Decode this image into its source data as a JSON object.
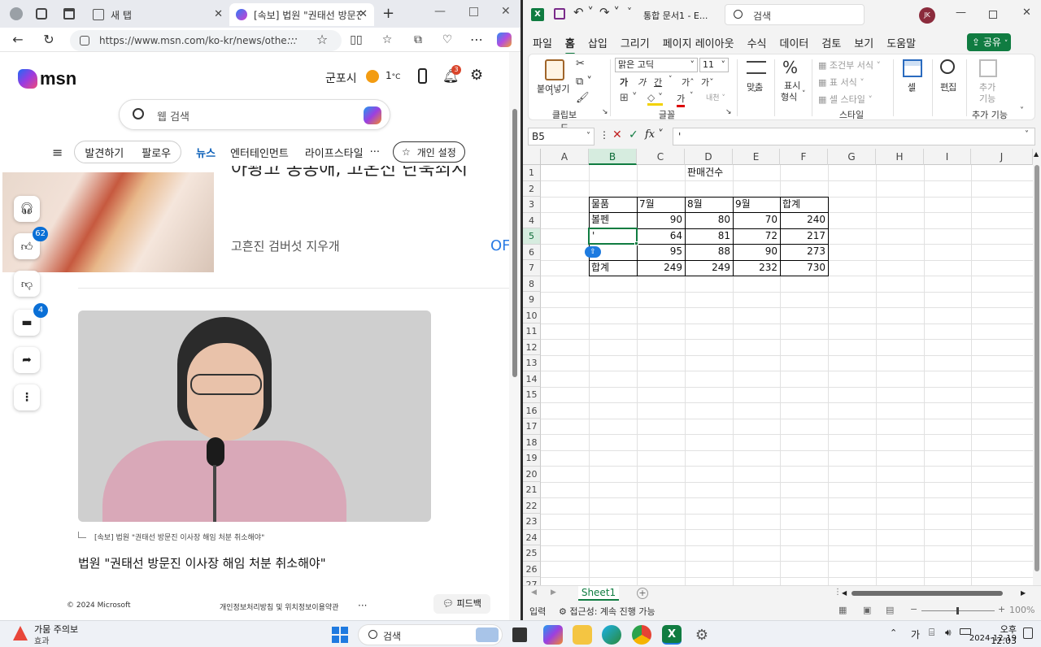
{
  "browser": {
    "tabs": [
      {
        "label": "새 탭",
        "icon": "new-tab-icon"
      },
      {
        "label": "[속보] 법원 \"권태선 방문진",
        "icon": "msn-icon"
      }
    ],
    "url": "https://www.msn.com/ko-kr/news/othe...",
    "msn": {
      "logo": "msn",
      "location": "군포시",
      "temperature": "1",
      "temp_unit": "°C",
      "notif_count": "3",
      "search_placeholder": "웹 검색",
      "nav_items": [
        "발견하기",
        "팔로우",
        "뉴스",
        "엔터테인먼트",
        "라이프스타일"
      ],
      "nav_more": "···",
      "personalize": "개인 설정",
      "headline_partial": "아꽝고 농농애, 고온신 난욱쇠시",
      "related_title": "고흔진 검버섯 지우개",
      "related_tag": "OF",
      "like_count": "62",
      "comment_count": "4",
      "caption": "[속보] 법원 \"권태선 방문진 이사장 해임 처분 취소해야\"",
      "article_title": "법원 \"권태선 방문진 이사장 해임 처분 취소해야\"",
      "footer_copyright": "© 2024 Microsoft",
      "footer_links": "개인정보처리방침 및 위치정보이용약관",
      "footer_more": "···",
      "feedback": "피드백"
    }
  },
  "excel": {
    "title": "통합 문서1 - E...",
    "search": "검색",
    "user_initials": "JK",
    "menu": [
      "파일",
      "홈",
      "삽입",
      "그리기",
      "페이지 레이아웃",
      "수식",
      "데이터",
      "검토",
      "보기",
      "도움말"
    ],
    "share": "공유",
    "ribbon": {
      "paste": "붙여넣기",
      "clipboard": "클립보드",
      "font_name": "맑은 고딕",
      "font_size": "11",
      "bold": "가",
      "italic": "가",
      "underline": "간",
      "grow": "가ˆ",
      "shrink": "가ˇ",
      "font_color": "가",
      "font_group": "글꼴",
      "align": "맞춤",
      "number": "표시\n형식",
      "number_l1": "표시",
      "number_l2": "형식",
      "cond_format": "조건부 서식",
      "table_format": "표 서식",
      "cell_style": "셀 스타일",
      "styles_group": "스타일",
      "cells": "셀",
      "editing": "편집",
      "addins_l1": "추가",
      "addins_l2": "기능",
      "addins_group": "추가 기능"
    },
    "name_box": "B5",
    "formula": "'",
    "columns": [
      "A",
      "B",
      "C",
      "D",
      "E",
      "F",
      "G",
      "H",
      "I",
      "J"
    ],
    "rows": [
      "1",
      "2",
      "3",
      "4",
      "5",
      "6",
      "7",
      "8",
      "9",
      "10",
      "11",
      "12",
      "13",
      "14",
      "15",
      "16",
      "17",
      "18",
      "19",
      "20",
      "21",
      "22",
      "23",
      "24",
      "25",
      "26",
      "27"
    ],
    "sheet": {
      "title": "판매건수",
      "header": [
        "물품",
        "7월",
        "8월",
        "9월",
        "합계"
      ],
      "data": [
        [
          "볼펜",
          "90",
          "80",
          "70",
          "240"
        ],
        [
          "'",
          "64",
          "81",
          "72",
          "217"
        ],
        [
          "",
          "95",
          "88",
          "90",
          "273"
        ],
        [
          "합계",
          "249",
          "249",
          "232",
          "730"
        ]
      ]
    },
    "sheet_tab": "Sheet1",
    "status_mode": "입력",
    "accessibility": "접근성: 계속 진행 가능",
    "zoom": "100%"
  },
  "taskbar": {
    "weather_alert_title": "가뭄 주의보",
    "weather_alert_sub": "효과",
    "search": "검색",
    "ime": "가",
    "time": "오후 12:03",
    "date": "2024-12-19"
  }
}
